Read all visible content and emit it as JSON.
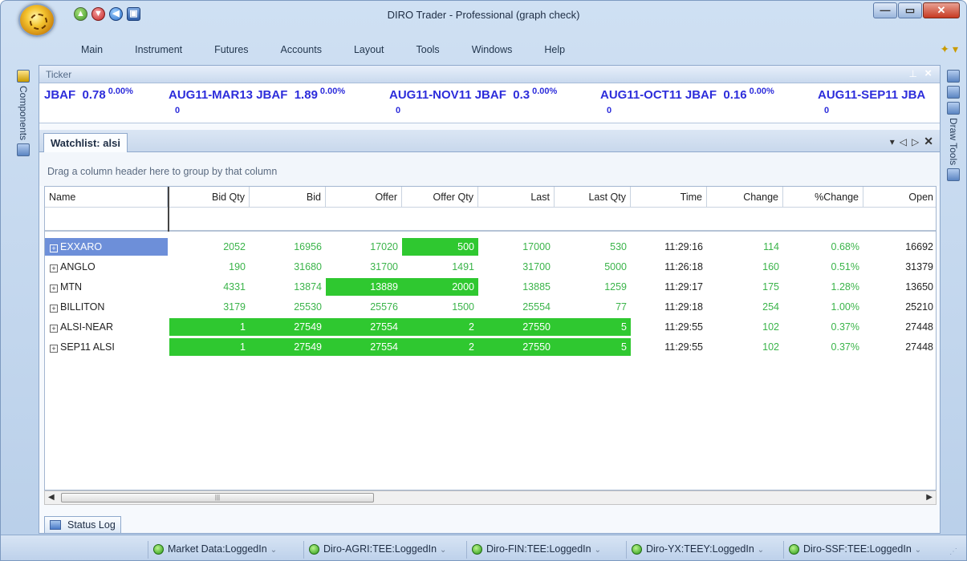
{
  "window": {
    "title": "DIRO Trader - Professional (graph check)",
    "minimize_glyph": "—",
    "maximize_glyph": "▭",
    "close_glyph": "✕"
  },
  "quick_access": [
    "▲",
    "▼",
    "◀",
    "▣"
  ],
  "menu": {
    "items": [
      "Main",
      "Instrument",
      "Futures",
      "Accounts",
      "Layout",
      "Tools",
      "Windows",
      "Help"
    ]
  },
  "rails": {
    "left_label": "Components",
    "right_label": "Draw Tools"
  },
  "ticker": {
    "title": "Ticker",
    "items": [
      {
        "symbol": "JBAF",
        "price": "0.78",
        "pct": "0.00%",
        "sub": ""
      },
      {
        "symbol": "AUG11-MAR13 JBAF",
        "price": "1.89",
        "pct": "0.00%",
        "sub": "0"
      },
      {
        "symbol": "AUG11-NOV11 JBAF",
        "price": "0.3",
        "pct": "0.00%",
        "sub": "0"
      },
      {
        "symbol": "AUG11-OCT11 JBAF",
        "price": "0.16",
        "pct": "0.00%",
        "sub": "0"
      },
      {
        "symbol": "AUG11-SEP11 JBA",
        "price": "",
        "pct": "",
        "sub": "0"
      }
    ]
  },
  "watchlist": {
    "tab_label": "Watchlist: alsi",
    "group_hint": "Drag a column header here to group by that column",
    "columns": [
      "Name",
      "Bid Qty",
      "Bid",
      "Offer",
      "Offer Qty",
      "Last",
      "Last Qty",
      "Time",
      "Change",
      "%Change",
      "Open"
    ],
    "rows": [
      {
        "name": "EXXARO",
        "bid_qty": "2052",
        "bid": "16956",
        "offer": "17020",
        "offer_qty": "500",
        "last": "17000",
        "last_qty": "530",
        "time": "11:29:16",
        "change": "114",
        "pct_change": "0.68%",
        "open": "16692"
      },
      {
        "name": "ANGLO",
        "bid_qty": "190",
        "bid": "31680",
        "offer": "31700",
        "offer_qty": "1491",
        "last": "31700",
        "last_qty": "5000",
        "time": "11:26:18",
        "change": "160",
        "pct_change": "0.51%",
        "open": "31379"
      },
      {
        "name": "MTN",
        "bid_qty": "4331",
        "bid": "13874",
        "offer": "13889",
        "offer_qty": "2000",
        "last": "13885",
        "last_qty": "1259",
        "time": "11:29:17",
        "change": "175",
        "pct_change": "1.28%",
        "open": "13650"
      },
      {
        "name": "BILLITON",
        "bid_qty": "3179",
        "bid": "25530",
        "offer": "25576",
        "offer_qty": "1500",
        "last": "25554",
        "last_qty": "77",
        "time": "11:29:18",
        "change": "254",
        "pct_change": "1.00%",
        "open": "25210"
      },
      {
        "name": "ALSI-NEAR",
        "bid_qty": "1",
        "bid": "27549",
        "offer": "27554",
        "offer_qty": "2",
        "last": "27550",
        "last_qty": "5",
        "time": "11:29:55",
        "change": "102",
        "pct_change": "0.37%",
        "open": "27448"
      },
      {
        "name": "SEP11 ALSI",
        "bid_qty": "1",
        "bid": "27549",
        "offer": "27554",
        "offer_qty": "2",
        "last": "27550",
        "last_qty": "5",
        "time": "11:29:55",
        "change": "102",
        "pct_change": "0.37%",
        "open": "27448"
      }
    ],
    "colors": {
      "up": "#3bb44a",
      "highlight": "#2fc830",
      "selected": "#6d8fd9"
    }
  },
  "status_log": {
    "label": "Status Log"
  },
  "statusbar": {
    "items": [
      "Market Data:LoggedIn",
      "Diro-AGRI:TEE:LoggedIn",
      "Diro-FIN:TEE:LoggedIn",
      "Diro-YX:TEEY:LoggedIn",
      "Diro-SSF:TEE:LoggedIn"
    ]
  }
}
